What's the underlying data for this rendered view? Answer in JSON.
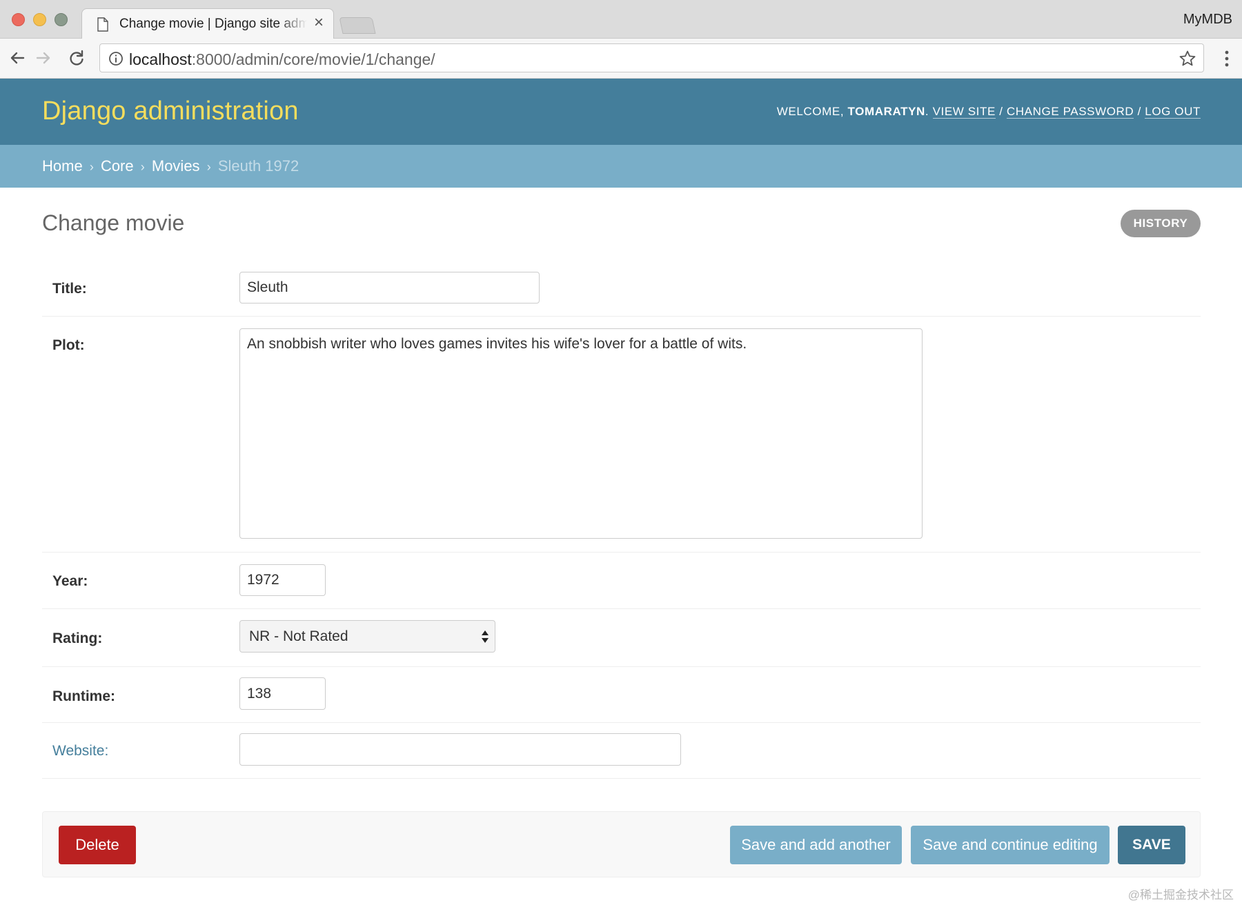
{
  "browser": {
    "tab_title": "Change movie | Django site admin",
    "tab_close": "×",
    "profile_name": "MyMDB",
    "url_host": "localhost",
    "url_rest": ":8000/admin/core/movie/1/change/",
    "icons": [
      "page-icon",
      "close-icon",
      "back-arrow-icon",
      "forward-arrow-icon",
      "reload-icon",
      "info-icon",
      "star-icon",
      "menu-dots-icon"
    ]
  },
  "header": {
    "branding": "Django administration",
    "welcome": "Welcome,",
    "username": "tomaratyn",
    "view_site": "View site",
    "change_password": "Change password",
    "log_out": "Log out",
    "separator": "/"
  },
  "breadcrumbs": {
    "items": [
      "Home",
      "Core",
      "Movies"
    ],
    "current": "Sleuth 1972",
    "separator": "›"
  },
  "page": {
    "title": "Change movie",
    "history_label": "History"
  },
  "form": {
    "title": {
      "label": "Title:",
      "value": "Sleuth"
    },
    "plot": {
      "label": "Plot:",
      "value": "An snobbish writer who loves games invites his wife's lover for a battle of wits."
    },
    "year": {
      "label": "Year:",
      "value": "1972"
    },
    "rating": {
      "label": "Rating:",
      "value": "NR - Not Rated"
    },
    "runtime": {
      "label": "Runtime:",
      "value": "138"
    },
    "website": {
      "label": "Website:",
      "value": ""
    }
  },
  "actions": {
    "delete": "Delete",
    "save_add_another": "Save and add another",
    "save_continue": "Save and continue editing",
    "save": "Save"
  },
  "colors": {
    "header_bg": "#447e9b",
    "branding": "#f5dd5d",
    "breadcrumbs_bg": "#79aec8",
    "delete_bg": "#ba2121",
    "save_bg": "#417690"
  },
  "watermark": "@稀土掘金技术社区"
}
